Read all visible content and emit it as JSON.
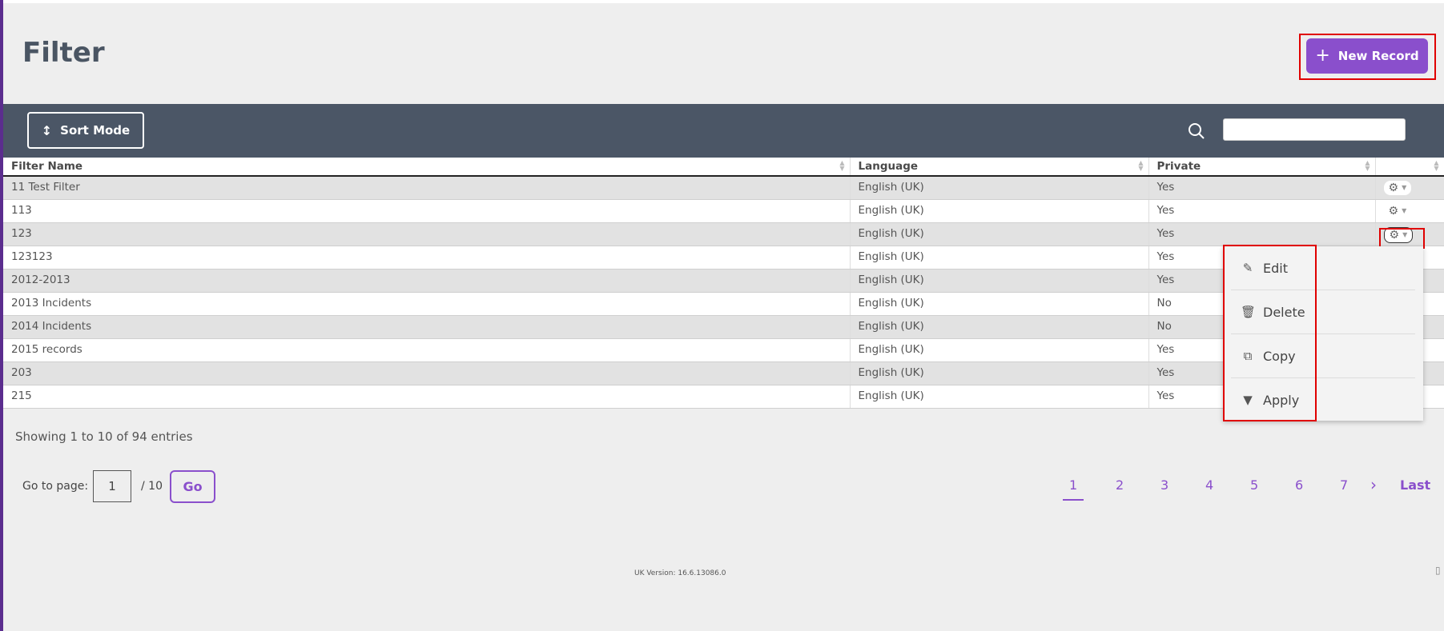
{
  "page": {
    "title": "Filter"
  },
  "header": {
    "new_record_label": "New Record"
  },
  "toolbar": {
    "sort_mode_label": "Sort Mode",
    "search_placeholder": ""
  },
  "table": {
    "columns": [
      "Filter Name",
      "Language",
      "Private",
      ""
    ],
    "rows": [
      {
        "name": "11 Test Filter",
        "language": "English (UK)",
        "private": "Yes"
      },
      {
        "name": "113",
        "language": "English (UK)",
        "private": "Yes"
      },
      {
        "name": "123",
        "language": "English (UK)",
        "private": "Yes"
      },
      {
        "name": "123123",
        "language": "English (UK)",
        "private": "Yes"
      },
      {
        "name": "2012-2013",
        "language": "English (UK)",
        "private": "Yes"
      },
      {
        "name": "2013 Incidents",
        "language": "English (UK)",
        "private": "No"
      },
      {
        "name": "2014 Incidents",
        "language": "English (UK)",
        "private": "No"
      },
      {
        "name": "2015 records",
        "language": "English (UK)",
        "private": "Yes"
      },
      {
        "name": "203",
        "language": "English (UK)",
        "private": "Yes"
      },
      {
        "name": "215",
        "language": "English (UK)",
        "private": "Yes"
      }
    ]
  },
  "actions_menu": {
    "items": [
      {
        "label": "Edit",
        "icon": "edit-icon"
      },
      {
        "label": "Delete",
        "icon": "trash-icon"
      },
      {
        "label": "Copy",
        "icon": "copy-icon"
      },
      {
        "label": "Apply",
        "icon": "filter-icon"
      }
    ]
  },
  "footer": {
    "showing": "Showing 1 to 10 of 94 entries",
    "goto_label": "Go to page:",
    "goto_value": "1",
    "goto_total": "/ 10",
    "go_label": "Go",
    "pages": [
      "1",
      "2",
      "3",
      "4",
      "5",
      "6",
      "7"
    ],
    "current_page": "1",
    "last_label": "Last",
    "version": "UK Version: 16.6.13086.0"
  },
  "colors": {
    "accent": "#8a4fcc",
    "toolbar": "#4b5666",
    "highlight": "#e00000"
  }
}
